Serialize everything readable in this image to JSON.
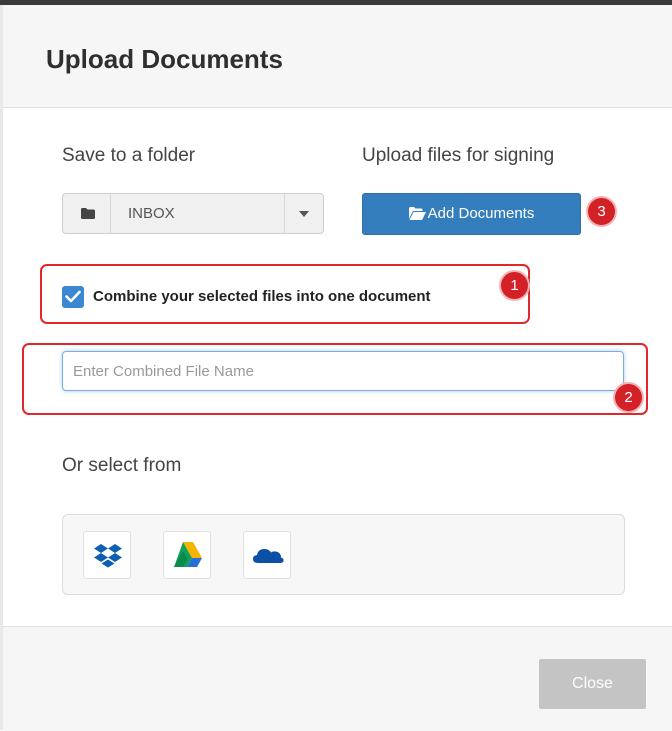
{
  "dialog": {
    "title": "Upload Documents"
  },
  "folder": {
    "label": "Save to a folder",
    "selected": "INBOX",
    "icon": "folder-icon"
  },
  "upload": {
    "label": "Upload files for signing",
    "button_label": "Add Documents",
    "button_icon": "folder-open-icon"
  },
  "combine": {
    "checked": true,
    "label": "Combine your selected files into one document"
  },
  "file_name": {
    "placeholder": "Enter Combined File Name",
    "value": ""
  },
  "sources": {
    "label": "Or select from",
    "items": [
      "dropbox-icon",
      "google-drive-icon",
      "onedrive-icon"
    ]
  },
  "callouts": {
    "combine_badge": "1",
    "file_name_badge": "2",
    "add_docs_badge": "3"
  },
  "footer": {
    "close_label": "Close"
  },
  "colors": {
    "primary": "#357ebd",
    "callout": "#e3262b",
    "checkbox": "#3b87d1",
    "close_disabled": "#c4c4c4"
  }
}
